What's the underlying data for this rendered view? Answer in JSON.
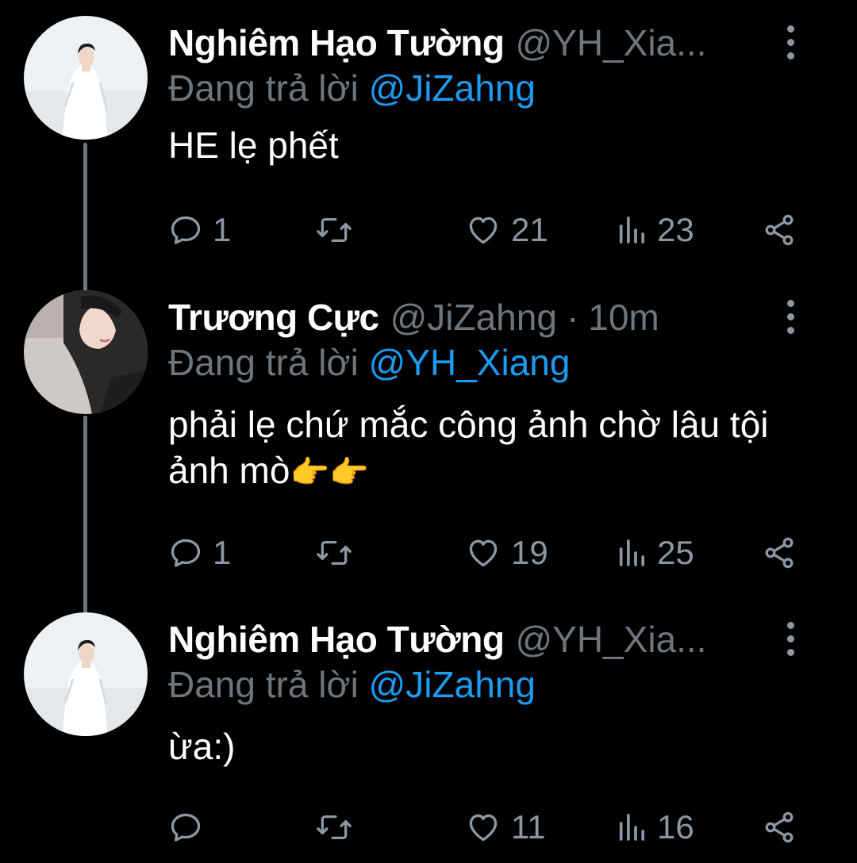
{
  "colors": {
    "background": "#000000",
    "text": "#ffffff",
    "secondary": "#6e767d",
    "link": "#1d9bf0",
    "icon": "#8b98a5"
  },
  "tweets": [
    {
      "display_name": "Nghiêm Hạo Tường",
      "handle": "@YH_Xia...",
      "dot": "",
      "time": "",
      "reply_prefix": "Đang trả lời",
      "reply_to": "@JiZahng",
      "text": "HE lẹ phết",
      "emoji": "",
      "avatar_icon": "avatar-photo-person-white-shirt",
      "actions": {
        "replies": "1",
        "retweets": "",
        "likes": "21",
        "views": "23"
      }
    },
    {
      "display_name": "Trương Cực",
      "handle": "@JiZahng",
      "dot": "·",
      "time": "10m",
      "reply_prefix": "Đang trả lời",
      "reply_to": "@YH_Xiang",
      "text": "phải lẹ chứ mắc công ảnh chờ lâu tội ảnh mò",
      "emoji": "👉👉",
      "avatar_icon": "avatar-photo-person-closeup",
      "actions": {
        "replies": "1",
        "retweets": "",
        "likes": "19",
        "views": "25"
      }
    },
    {
      "display_name": "Nghiêm Hạo Tường",
      "handle": "@YH_Xia...",
      "dot": "",
      "time": "",
      "reply_prefix": "Đang trả lời",
      "reply_to": "@JiZahng",
      "text": "ừa:)",
      "emoji": "",
      "avatar_icon": "avatar-photo-person-white-shirt",
      "actions": {
        "replies": "",
        "retweets": "",
        "likes": "11",
        "views": "16"
      }
    }
  ]
}
